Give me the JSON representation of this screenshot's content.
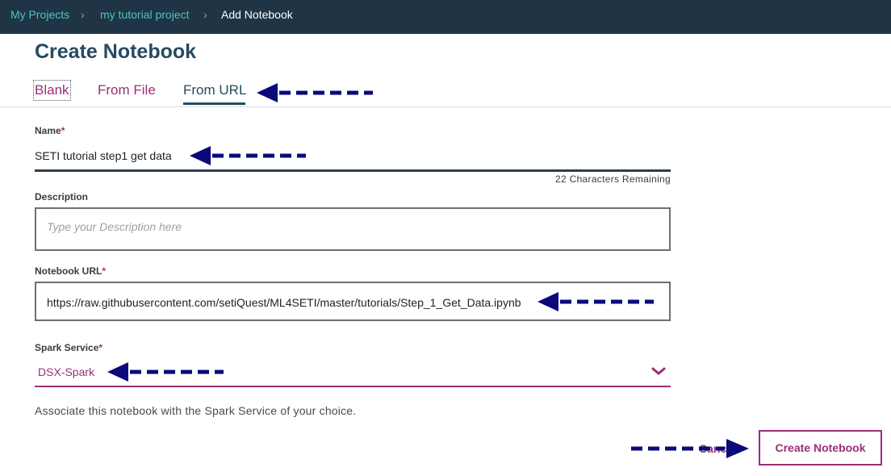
{
  "breadcrumb": {
    "items": [
      "My Projects",
      "my tutorial project",
      "Add Notebook"
    ],
    "separator_icon": "chevron-right-icon"
  },
  "page": {
    "title": "Create Notebook"
  },
  "tabs": [
    {
      "label": "Blank",
      "active": false
    },
    {
      "label": "From File",
      "active": false
    },
    {
      "label": "From URL",
      "active": true
    }
  ],
  "form": {
    "name": {
      "label": "Name",
      "required_mark": "*",
      "value": "SETI tutorial step1 get data",
      "remaining": "22 Characters Remaining"
    },
    "description": {
      "label": "Description",
      "placeholder": "Type your Description here",
      "value": ""
    },
    "notebook_url": {
      "label": "Notebook URL",
      "required_mark": "*",
      "value": "https://raw.githubusercontent.com/setiQuest/ML4SETI/master/tutorials/Step_1_Get_Data.ipynb"
    },
    "spark_service": {
      "label": "Spark Service",
      "required_mark": "*",
      "selected": "DSX-Spark",
      "dropdown_icon": "chevron-down-icon",
      "helper": "Associate this notebook with the Spark Service of your choice."
    }
  },
  "actions": {
    "cancel_label": "Canc",
    "create_label": "Create Notebook"
  },
  "colors": {
    "topbar": "#1f3444",
    "accent": "#9b2e78",
    "link": "#4fc3c3",
    "heading": "#264a60",
    "annotation_arrow": "#0a0a7a"
  }
}
